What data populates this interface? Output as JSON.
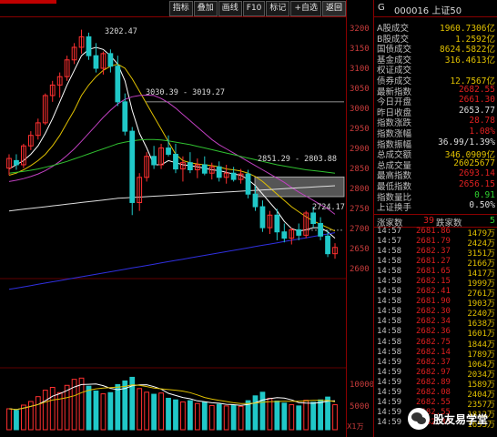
{
  "toolbar": {
    "buttons": [
      "指标",
      "叠加",
      "画线",
      "F10",
      "标记",
      "+自选",
      "返回"
    ]
  },
  "price_axis": {
    "labels": [
      "3200",
      "3150",
      "3100",
      "3050",
      "3000",
      "2950",
      "2900",
      "2850",
      "2800",
      "2750",
      "2700",
      "2650",
      "2600"
    ]
  },
  "volume_axis": {
    "labels": [
      "10000",
      "5000"
    ],
    "unit": "X1万"
  },
  "chart": {
    "annotations": {
      "high": "3202.47",
      "box1": "3030.39 - 3019.27",
      "box2": "2851.29 - 2803.88",
      "low": "2724.17"
    }
  },
  "panel": {
    "header": {
      "icon": "G",
      "name": "000016 上证50"
    },
    "stats": [
      {
        "label": "A股成交",
        "value": "1960.7306亿",
        "color": "#e0c000"
      },
      {
        "label": "B股成交",
        "value": "1.2592亿",
        "color": "#e0c000"
      },
      {
        "label": "国债成交",
        "value": "8624.5822亿",
        "color": "#e0c000"
      },
      {
        "label": "基金成交",
        "value": "316.4613亿",
        "color": "#e0c000"
      },
      {
        "label": "权证成交",
        "value": "",
        "color": "#e0c000"
      },
      {
        "label": "债券成交",
        "value": "12.7567亿",
        "color": "#e0c000"
      },
      {
        "label": "最新指数",
        "value": "2682.55",
        "color": "#e02020"
      },
      {
        "label": "今日开盘",
        "value": "2661.30",
        "color": "#e02020"
      },
      {
        "label": "昨日收盘",
        "value": "2653.77",
        "color": "#dddddd"
      },
      {
        "label": "指数涨跌",
        "value": "28.78",
        "color": "#e02020"
      },
      {
        "label": "指数涨幅",
        "value": "1.08%",
        "color": "#e02020"
      },
      {
        "label": "指数振幅",
        "value": "36.99/1.39%",
        "color": "#dddddd"
      },
      {
        "label": "总成交额",
        "value": "346.0909亿",
        "color": "#e0c000"
      },
      {
        "label": "总成交量",
        "value": "26025677",
        "color": "#e0c000"
      },
      {
        "label": "最高指数",
        "value": "2693.14",
        "color": "#e02020"
      },
      {
        "label": "最低指数",
        "value": "2656.15",
        "color": "#e02020"
      },
      {
        "label": "指数量比",
        "value": "0.91",
        "color": "#30d030"
      },
      {
        "label": "上证换手",
        "value": "0.50%",
        "color": "#dddddd"
      }
    ],
    "updown": {
      "up_label": "涨家数",
      "up_value": "39",
      "down_label": "跌家数",
      "down_value": "5"
    },
    "ticks": [
      {
        "time": "14:57",
        "price": "2681.86",
        "vol": "1479万"
      },
      {
        "time": "14:57",
        "price": "2681.79",
        "vol": "2424万"
      },
      {
        "time": "14:58",
        "price": "2682.37",
        "vol": "3151万"
      },
      {
        "time": "14:58",
        "price": "2681.27",
        "vol": "2166万"
      },
      {
        "time": "14:58",
        "price": "2681.65",
        "vol": "1417万"
      },
      {
        "time": "14:58",
        "price": "2682.15",
        "vol": "1999万"
      },
      {
        "time": "14:58",
        "price": "2682.41",
        "vol": "2761万"
      },
      {
        "time": "14:58",
        "price": "2681.90",
        "vol": "1903万"
      },
      {
        "time": "14:58",
        "price": "2682.30",
        "vol": "2240万"
      },
      {
        "time": "14:58",
        "price": "2682.34",
        "vol": "1638万"
      },
      {
        "time": "14:58",
        "price": "2682.36",
        "vol": "1601万"
      },
      {
        "time": "14:58",
        "price": "2682.75",
        "vol": "1844万"
      },
      {
        "time": "14:58",
        "price": "2682.14",
        "vol": "1789万"
      },
      {
        "time": "14:59",
        "price": "2682.37",
        "vol": "1064万"
      },
      {
        "time": "14:59",
        "price": "2682.97",
        "vol": "2034万"
      },
      {
        "time": "14:59",
        "price": "2682.89",
        "vol": "1589万"
      },
      {
        "time": "14:59",
        "price": "2682.08",
        "vol": "2404万"
      },
      {
        "time": "14:59",
        "price": "2682.55",
        "vol": "2357万"
      },
      {
        "time": "14:59",
        "price": "2682.55",
        "vol": "1812万"
      },
      {
        "time": "14:59",
        "price": "2682.33",
        "vol": "1653万"
      }
    ],
    "watermark": "股友易学堂"
  },
  "chart_data": {
    "type": "candlestick",
    "ylim": [
      2600,
      3225
    ],
    "candles": [
      {
        "o": 2872,
        "h": 2905,
        "l": 2855,
        "c": 2895
      },
      {
        "o": 2890,
        "h": 2905,
        "l": 2868,
        "c": 2880
      },
      {
        "o": 2880,
        "h": 2930,
        "l": 2872,
        "c": 2925
      },
      {
        "o": 2925,
        "h": 2960,
        "l": 2915,
        "c": 2950
      },
      {
        "o": 2950,
        "h": 2990,
        "l": 2940,
        "c": 2980
      },
      {
        "o": 2980,
        "h": 3050,
        "l": 2975,
        "c": 3045
      },
      {
        "o": 3045,
        "h": 3080,
        "l": 3030,
        "c": 3070
      },
      {
        "o": 3070,
        "h": 3100,
        "l": 3040,
        "c": 3090
      },
      {
        "o": 3090,
        "h": 3140,
        "l": 3080,
        "c": 3130
      },
      {
        "o": 3130,
        "h": 3170,
        "l": 3120,
        "c": 3160
      },
      {
        "o": 3160,
        "h": 3202,
        "l": 3145,
        "c": 3185
      },
      {
        "o": 3185,
        "h": 3195,
        "l": 3130,
        "c": 3140
      },
      {
        "o": 3140,
        "h": 3170,
        "l": 3100,
        "c": 3110
      },
      {
        "o": 3110,
        "h": 3150,
        "l": 3095,
        "c": 3145
      },
      {
        "o": 3145,
        "h": 3155,
        "l": 3100,
        "c": 3115
      },
      {
        "o": 3115,
        "h": 3140,
        "l": 3020,
        "c": 3030
      },
      {
        "o": 3030,
        "h": 3050,
        "l": 2950,
        "c": 2960
      },
      {
        "o": 2960,
        "h": 2970,
        "l": 2760,
        "c": 2790
      },
      {
        "o": 2790,
        "h": 2860,
        "l": 2770,
        "c": 2850
      },
      {
        "o": 2850,
        "h": 2910,
        "l": 2840,
        "c": 2900
      },
      {
        "o": 2900,
        "h": 2925,
        "l": 2870,
        "c": 2880
      },
      {
        "o": 2880,
        "h": 2930,
        "l": 2870,
        "c": 2920
      },
      {
        "o": 2920,
        "h": 2950,
        "l": 2900,
        "c": 2905
      },
      {
        "o": 2905,
        "h": 2930,
        "l": 2860,
        "c": 2870
      },
      {
        "o": 2870,
        "h": 2900,
        "l": 2840,
        "c": 2885
      },
      {
        "o": 2885,
        "h": 2910,
        "l": 2860,
        "c": 2868
      },
      {
        "o": 2868,
        "h": 2895,
        "l": 2848,
        "c": 2880
      },
      {
        "o": 2880,
        "h": 2900,
        "l": 2855,
        "c": 2860
      },
      {
        "o": 2860,
        "h": 2885,
        "l": 2845,
        "c": 2875
      },
      {
        "o": 2875,
        "h": 2888,
        "l": 2840,
        "c": 2850
      },
      {
        "o": 2850,
        "h": 2880,
        "l": 2835,
        "c": 2860
      },
      {
        "o": 2860,
        "h": 2875,
        "l": 2840,
        "c": 2845
      },
      {
        "o": 2845,
        "h": 2870,
        "l": 2835,
        "c": 2858
      },
      {
        "o": 2858,
        "h": 2868,
        "l": 2800,
        "c": 2810
      },
      {
        "o": 2810,
        "h": 2830,
        "l": 2770,
        "c": 2780
      },
      {
        "o": 2780,
        "h": 2795,
        "l": 2720,
        "c": 2730
      },
      {
        "o": 2730,
        "h": 2770,
        "l": 2715,
        "c": 2760
      },
      {
        "o": 2760,
        "h": 2775,
        "l": 2700,
        "c": 2720
      },
      {
        "o": 2720,
        "h": 2740,
        "l": 2695,
        "c": 2705
      },
      {
        "o": 2705,
        "h": 2730,
        "l": 2690,
        "c": 2725
      },
      {
        "o": 2725,
        "h": 2740,
        "l": 2700,
        "c": 2712
      },
      {
        "o": 2712,
        "h": 2770,
        "l": 2705,
        "c": 2765
      },
      {
        "o": 2765,
        "h": 2780,
        "l": 2730,
        "c": 2740
      },
      {
        "o": 2740,
        "h": 2755,
        "l": 2700,
        "c": 2710
      },
      {
        "o": 2710,
        "h": 2724,
        "l": 2660,
        "c": 2668
      },
      {
        "o": 2668,
        "h": 2693,
        "l": 2656,
        "c": 2683
      }
    ],
    "volumes": [
      5200,
      4800,
      6100,
      7000,
      8200,
      9800,
      10500,
      9200,
      11000,
      12500,
      12800,
      10800,
      9600,
      8900,
      9200,
      11200,
      12100,
      13000,
      10200,
      9300,
      8800,
      9100,
      7800,
      7400,
      6900,
      7200,
      6500,
      6800,
      6000,
      6300,
      5900,
      6100,
      5800,
      7200,
      8400,
      9300,
      7800,
      7100,
      6600,
      6200,
      5900,
      7300,
      6800,
      7400,
      8100,
      6200
    ],
    "ma_lines": [
      {
        "name": "MA5",
        "color": "#ffffff",
        "values": [
          2870,
          2880,
          2890,
          2905,
          2925,
          2955,
          2990,
          3030,
          3070,
          3105,
          3140,
          3155,
          3160,
          3155,
          3140,
          3120,
          3080,
          3010,
          2955,
          2920,
          2880,
          2880,
          2890,
          2885,
          2880,
          2878,
          2875,
          2872,
          2868,
          2866,
          2862,
          2858,
          2855,
          2845,
          2830,
          2810,
          2790,
          2770,
          2745,
          2728,
          2722,
          2725,
          2730,
          2730,
          2720,
          2705
        ]
      },
      {
        "name": "MA10",
        "color": "#e0c000",
        "values": [
          2855,
          2860,
          2868,
          2878,
          2890,
          2905,
          2925,
          2950,
          2980,
          3010,
          3045,
          3070,
          3090,
          3105,
          3115,
          3120,
          3110,
          3085,
          3055,
          3025,
          2995,
          2965,
          2935,
          2905,
          2890,
          2885,
          2882,
          2880,
          2878,
          2875,
          2870,
          2868,
          2865,
          2860,
          2852,
          2840,
          2825,
          2810,
          2795,
          2780,
          2768,
          2756,
          2746,
          2738,
          2730,
          2722
        ]
      },
      {
        "name": "MA20",
        "color": "#c040c0",
        "values": [
          2840,
          2843,
          2847,
          2852,
          2858,
          2866,
          2876,
          2888,
          2902,
          2918,
          2936,
          2955,
          2974,
          2993,
          3010,
          3025,
          3036,
          3042,
          3045,
          3046,
          3045,
          3038,
          3028,
          3015,
          3000,
          2985,
          2970,
          2955,
          2940,
          2928,
          2918,
          2908,
          2898,
          2888,
          2878,
          2868,
          2858,
          2848,
          2838,
          2826,
          2815,
          2805,
          2795,
          2785,
          2775,
          2762
        ]
      },
      {
        "name": "MA60",
        "color": "#30c030",
        "values": [
          2860,
          2862,
          2864,
          2867,
          2870,
          2874,
          2878,
          2883,
          2888,
          2894,
          2900,
          2906,
          2912,
          2918,
          2924,
          2930,
          2934,
          2937,
          2939,
          2940,
          2940,
          2939,
          2937,
          2934,
          2931,
          2928,
          2924,
          2920,
          2916,
          2912,
          2908,
          2904,
          2900,
          2896,
          2892,
          2888,
          2884,
          2880,
          2877,
          2874,
          2871,
          2868,
          2866,
          2864,
          2862,
          2860
        ]
      },
      {
        "name": "MA120",
        "color": "#dddddd",
        "values": [
          2770,
          2772,
          2774,
          2776,
          2778,
          2780,
          2782,
          2784,
          2786,
          2788,
          2790,
          2792,
          2794,
          2796,
          2798,
          2800,
          2801,
          2802,
          2803,
          2804,
          2805,
          2806,
          2807,
          2808,
          2809,
          2810,
          2811,
          2812,
          2813,
          2814,
          2815,
          2816,
          2817,
          2818,
          2819,
          2820,
          2821,
          2822,
          2823,
          2824,
          2825,
          2826,
          2827,
          2828,
          2829,
          2830
        ]
      },
      {
        "name": "MA250",
        "color": "#3030e0",
        "values": [
          2583,
          2586,
          2589,
          2592,
          2595,
          2598,
          2601,
          2604,
          2607,
          2610,
          2613,
          2616,
          2619,
          2622,
          2625,
          2628,
          2631,
          2634,
          2637,
          2640,
          2643,
          2646,
          2649,
          2652,
          2655,
          2658,
          2661,
          2664,
          2667,
          2670,
          2673,
          2676,
          2679,
          2682,
          2685,
          2688,
          2691,
          2694,
          2697,
          2700,
          2703,
          2706,
          2709,
          2712,
          2715,
          2718
        ]
      }
    ]
  }
}
